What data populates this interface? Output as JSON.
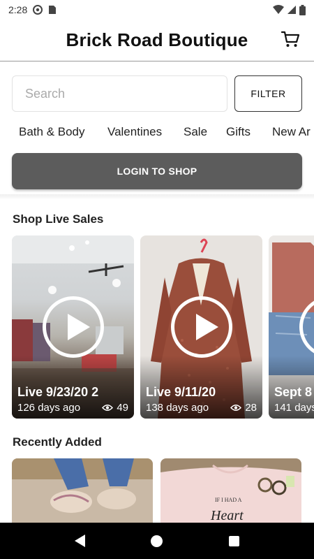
{
  "status_bar": {
    "time": "2:28",
    "icons": [
      "at-sign-icon",
      "sim-card-icon",
      "wifi-icon",
      "signal-icon",
      "battery-icon"
    ]
  },
  "app": {
    "title": "Brick Road Boutique",
    "cart_icon": "cart-icon"
  },
  "search": {
    "placeholder": "Search",
    "value": "",
    "filter_label": "FILTER"
  },
  "categories": [
    "Bath & Body",
    "Valentines",
    "Sale",
    "Gifts",
    "New Ar"
  ],
  "login_label": "LOGIN TO SHOP",
  "live_section": {
    "title": "Shop Live Sales",
    "items": [
      {
        "title": "Live 9/23/20 2",
        "ago": "126 days ago",
        "views": "49"
      },
      {
        "title": "Live 9/11/20",
        "ago": "138 days ago",
        "views": "28"
      },
      {
        "title": "Sept 8",
        "ago": "141 days",
        "views": ""
      }
    ]
  },
  "recent_section": {
    "title": "Recently Added",
    "items": [
      "recent-item-jeans-shoes",
      "recent-item-pink-sweatshirt"
    ]
  },
  "colors": {
    "accent": "#5c5c5c",
    "background": "#ffffff",
    "nav": "#000000"
  }
}
